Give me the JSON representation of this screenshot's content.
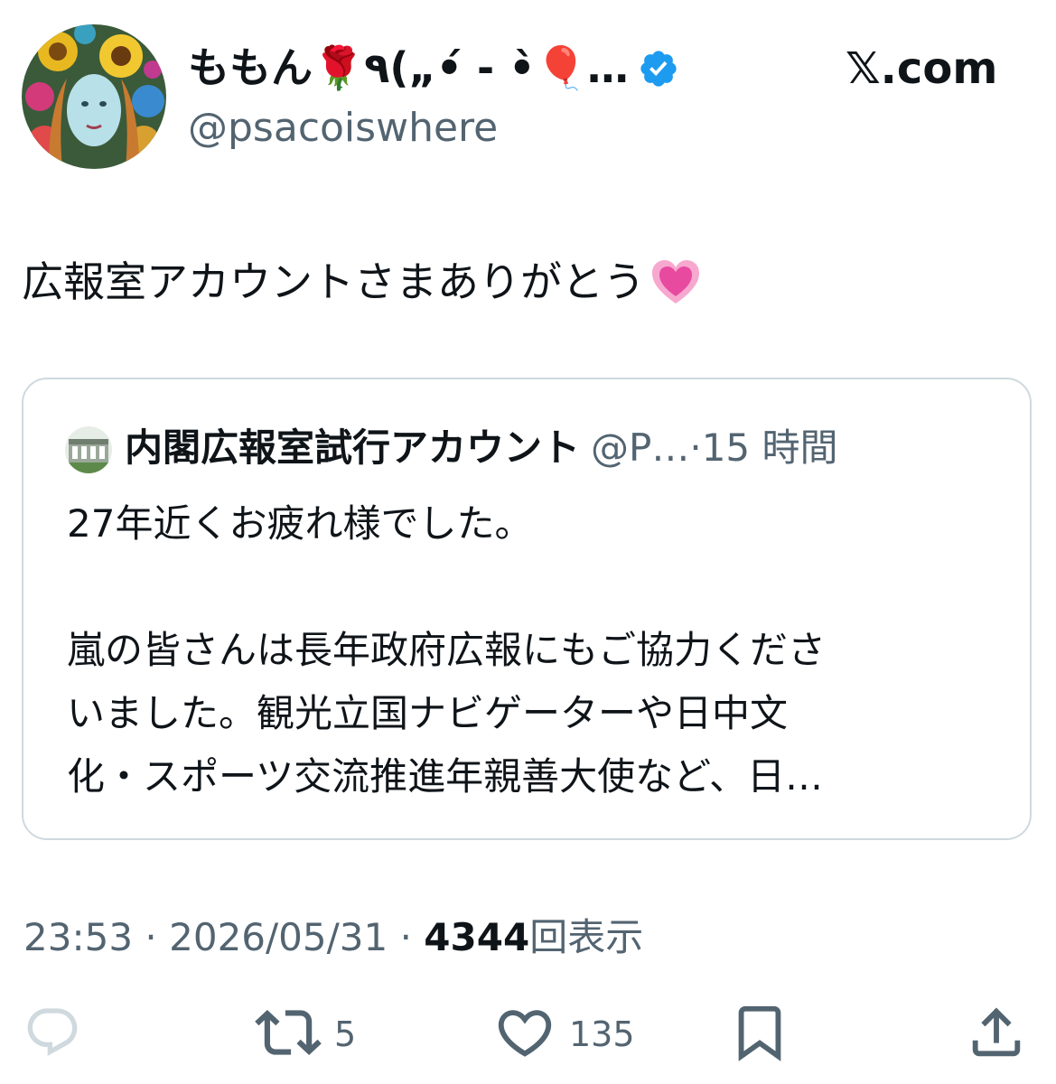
{
  "author": {
    "display_name": "ももん🌹٩(„•́ - •̀🎈…",
    "handle": "@psacoiswhere",
    "verified": true
  },
  "brand": {
    "label": "𝕏.com"
  },
  "tweet": {
    "text": "広報室アカウントさまありがとう"
  },
  "quote": {
    "name": "内閣広報室試行アカウント",
    "handle": "@P…",
    "separator": "·",
    "time": "15 時間",
    "line1": "27年近くお疲れ様でした。",
    "line2": "嵐の皆さんは長年政府広報にもご協力くださ",
    "line3": "いました。観光立国ナビゲーターや日中文",
    "line4": "化・スポーツ交流推進年親善大使など、日…"
  },
  "meta": {
    "time": "23:53",
    "sep1": "·",
    "date": "2026/05/31",
    "sep2": "·",
    "views_count": "4344",
    "views_label": "回表示"
  },
  "actions": {
    "retweet_count": "5",
    "like_count": "135"
  },
  "colors": {
    "text": "#0f1419",
    "secondary": "#536471",
    "border": "#cfd9de",
    "verified": "#1d9bf0",
    "heart_emoji": "#e84aa0"
  },
  "icons": [
    "verified-badge-icon",
    "sparkling-heart-icon",
    "reply-icon",
    "retweet-icon",
    "like-icon",
    "bookmark-icon",
    "share-icon"
  ]
}
